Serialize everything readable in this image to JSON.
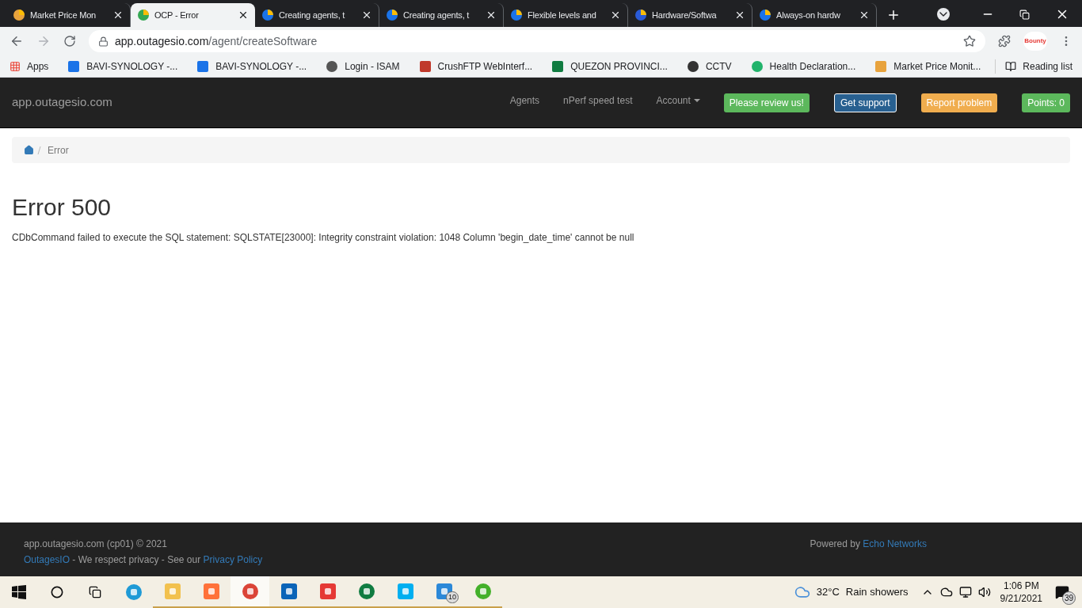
{
  "browser": {
    "tabs": [
      {
        "title": "Market Price Mon",
        "selected": false
      },
      {
        "title": "OCP - Error",
        "selected": true
      },
      {
        "title": "Creating agents, t",
        "selected": false
      },
      {
        "title": "Creating agents, t",
        "selected": false
      },
      {
        "title": "Flexible levels and",
        "selected": false
      },
      {
        "title": "Hardware/Softwa",
        "selected": false
      },
      {
        "title": "Always-on hardw",
        "selected": false
      }
    ],
    "address": {
      "host": "app.outagesio.com",
      "path": "/agent/createSoftware"
    },
    "profile": "Bounty",
    "bookmarks": [
      "Apps",
      "BAVI-SYNOLOGY -...",
      "BAVI-SYNOLOGY -...",
      "Login - ISAM",
      "CrushFTP WebInterf...",
      "QUEZON PROVINCI...",
      "CCTV",
      "Health Declaration...",
      "Market Price Monit..."
    ],
    "reading_list": "Reading list"
  },
  "navbar": {
    "brand": "app.outagesio.com",
    "links": [
      {
        "label": "Agents",
        "dropdown": false
      },
      {
        "label": "nPerf speed test",
        "dropdown": false
      },
      {
        "label": "Account",
        "dropdown": true
      }
    ],
    "buttons": [
      {
        "label": "Please review us!",
        "color": "#5cb85c"
      },
      {
        "label": "Get support",
        "color": "#286090"
      },
      {
        "label": "Report problem",
        "color": "#f0ad4e"
      },
      {
        "label": "Points: 0",
        "color": "#5cb85c"
      }
    ]
  },
  "breadcrumb": [
    "Error"
  ],
  "error": {
    "title": "Error 500",
    "message": "CDbCommand failed to execute the SQL statement: SQLSTATE[23000]: Integrity constraint violation: 1048 Column 'begin_date_time' cannot be null"
  },
  "footer": {
    "copyright": "app.outagesio.com (cp01) © 2021",
    "privacy_link": "OutagesIO",
    "privacy_text": " - We respect privacy - See our ",
    "policy_link": "Privacy Policy",
    "powered_text": "Powered by ",
    "powered_link": "Echo Networks"
  },
  "taskbar": {
    "apps": [
      {
        "running": false,
        "selected": false
      },
      {
        "running": true,
        "selected": false
      },
      {
        "running": true,
        "selected": false
      },
      {
        "running": true,
        "selected": true
      },
      {
        "running": true,
        "selected": false
      },
      {
        "running": true,
        "selected": false
      },
      {
        "running": true,
        "selected": false
      },
      {
        "running": true,
        "selected": false
      },
      {
        "running": true,
        "selected": false,
        "badge": "10"
      },
      {
        "running": true,
        "selected": false
      }
    ],
    "weather": {
      "temp": "32°C",
      "text": "Rain showers"
    },
    "time": "1:06 PM",
    "date": "9/21/2021",
    "notifications": "39"
  }
}
